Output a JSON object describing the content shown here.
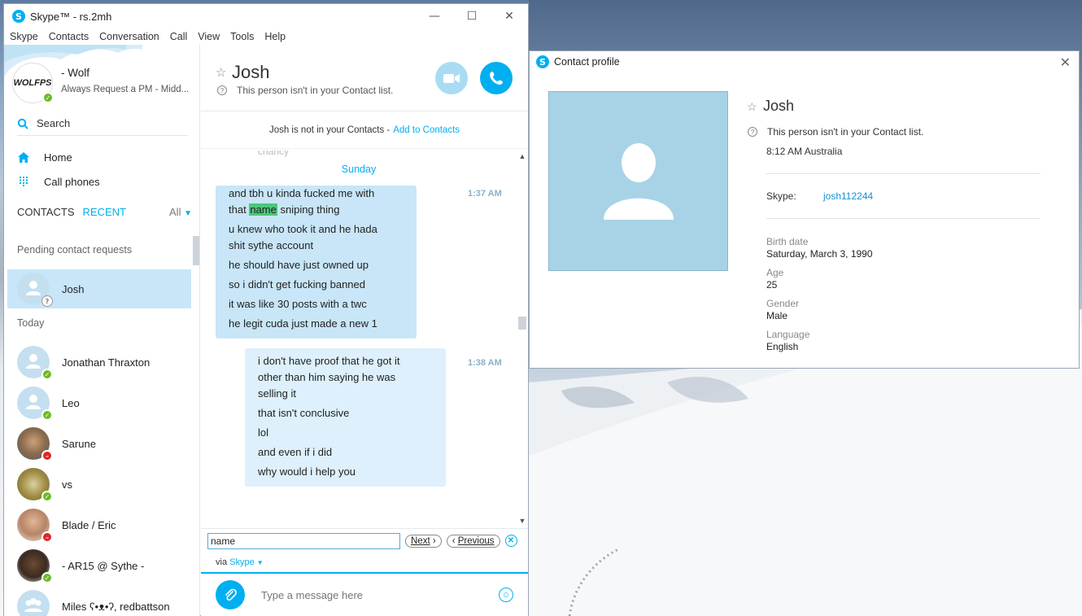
{
  "main_window": {
    "title": "Skype™ - rs.2mh",
    "controls": {
      "minimize": "—",
      "maximize": "☐",
      "close": "✕"
    },
    "menu": [
      "Skype",
      "Contacts",
      "Conversation",
      "Call",
      "View",
      "Tools",
      "Help"
    ]
  },
  "sidebar": {
    "profile": {
      "avatar_text": "WOLFPS",
      "name": "- Wolf",
      "mood": "Always Request a PM - Midd..."
    },
    "search_label": "Search",
    "nav": [
      {
        "label": "Home",
        "icon": "home-icon"
      },
      {
        "label": "Call phones",
        "icon": "dialpad-icon"
      }
    ],
    "tabs": {
      "contacts": "CONTACTS",
      "recent": "RECENT",
      "filter": "All"
    },
    "pending_header": "Pending contact requests",
    "pending": [
      {
        "name": "Josh",
        "presence": "unknown"
      }
    ],
    "today_header": "Today",
    "contacts": [
      {
        "name": "Jonathan Thraxton",
        "presence": "online"
      },
      {
        "name": "Leo",
        "presence": "online"
      },
      {
        "name": "Sarune",
        "presence": "busy"
      },
      {
        "name": "vs",
        "presence": "online"
      },
      {
        "name": "Blade / Eric",
        "presence": "busy"
      },
      {
        "name": "- AR15 @ Sythe -",
        "presence": "online"
      },
      {
        "name": "Miles ʕ•ᴥ•ʔ, redbattson",
        "presence": "group"
      }
    ]
  },
  "chat": {
    "contact_name": "Josh",
    "status": "This person isn't in your Contact list.",
    "notice_text": "Josh is not in your Contacts -",
    "notice_link": "Add to Contacts",
    "faded_text": "chancy",
    "day_label": "Sunday",
    "messages": [
      {
        "time": "1:37 AM",
        "from": "them",
        "lines": [
          "and tbh u kinda fucked me with",
          "u knew who took it and he hada",
          "shit sythe account",
          "he should have just owned up",
          "so i didn't get fucking banned",
          "it was like 30 posts with a twc",
          "he legit cuda just made a new 1"
        ],
        "line2_pre": "that",
        "line2_highlight": "name",
        "line2_post": "sniping thing"
      },
      {
        "time": "1:38 AM",
        "from": "me",
        "lines": [
          "i don't have proof that he got it",
          "other than him saying he was",
          "selling it",
          "that isn't conclusive",
          "lol",
          "and even if i did",
          "why would i help you"
        ]
      }
    ],
    "find": {
      "value": "name",
      "next": "Next",
      "previous": "Previous"
    },
    "via_label": "via",
    "via_service": "Skype",
    "compose_placeholder": "Type a message here"
  },
  "profile_window": {
    "title": "Contact profile",
    "name": "Josh",
    "status": "This person isn't in your Contact list.",
    "local_time": "8:12 AM Australia",
    "skype_label": "Skype:",
    "skype_id": "josh112244",
    "fields": [
      {
        "label": "Birth date",
        "value": "Saturday, March 3, 1990"
      },
      {
        "label": "Age",
        "value": "25"
      },
      {
        "label": "Gender",
        "value": "Male"
      },
      {
        "label": "Language",
        "value": "English"
      }
    ]
  },
  "colors": {
    "accent": "#00aff0",
    "online": "#6bbb24",
    "busy": "#e2252a",
    "bubble_them": "#c8e6f8",
    "bubble_me": "#ddf0fb",
    "highlight": "#4bc77a"
  }
}
